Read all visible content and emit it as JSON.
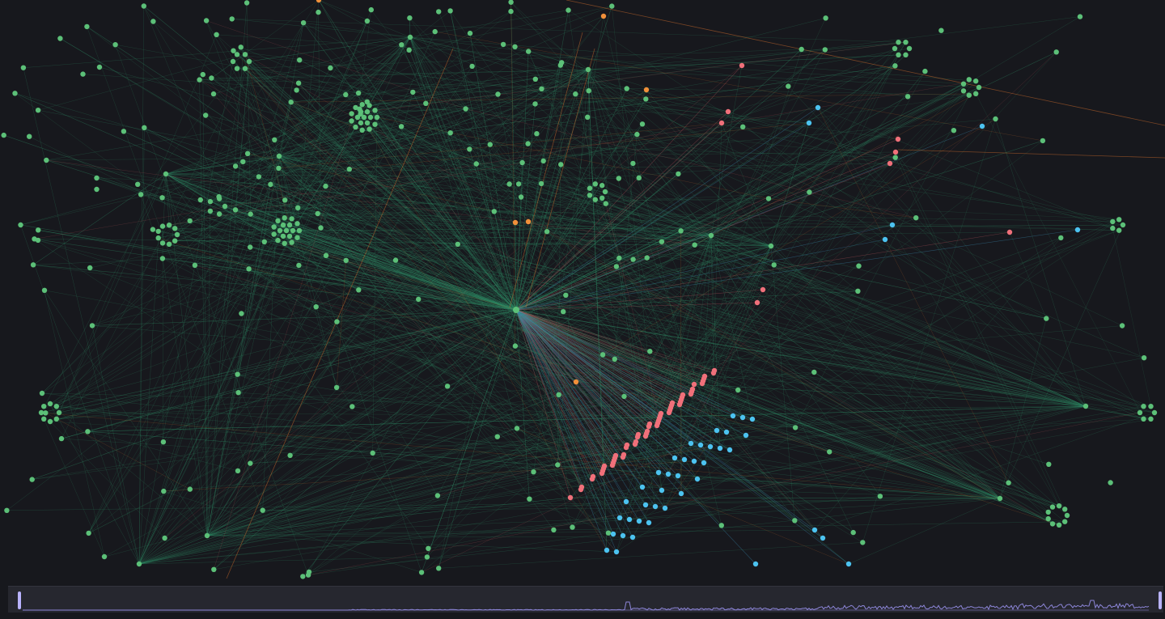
{
  "colors": {
    "background": "#17181d",
    "edge_default": "#2f8a63",
    "edge_red": "#b8555a",
    "edge_blue": "#3c8fb5",
    "edge_orange": "#c86a2b",
    "node_green": "#5cc078",
    "node_red": "#f0707a",
    "node_blue": "#4cc3f0",
    "node_orange": "#f0903a",
    "timeline_bg": "#26272f",
    "timeline_line": "#8d86d9",
    "timeline_handle": "#b9b3ff"
  },
  "graph": {
    "hub_node": "central-hub",
    "node_categories": [
      "green",
      "red",
      "blue",
      "orange"
    ]
  },
  "timeline": {
    "range_start": 0,
    "range_end": 1,
    "activity_trend": "low-then-rising"
  }
}
